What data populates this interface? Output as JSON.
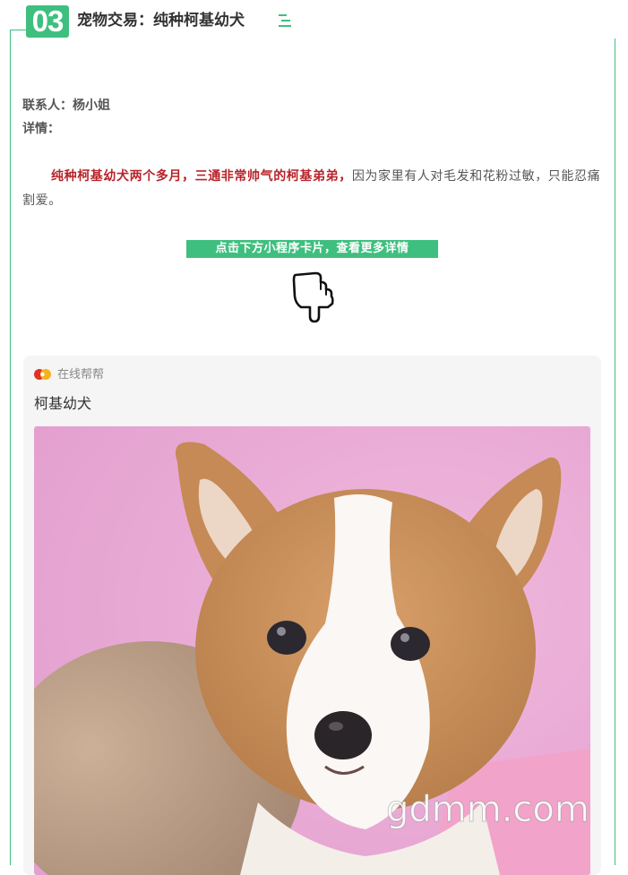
{
  "section": {
    "number": "03",
    "title": "宠物交易：纯种柯基幼犬",
    "title_icon": "menu-lines-icon"
  },
  "contact": {
    "text": "联系人：杨小姐"
  },
  "details": {
    "label": "详情："
  },
  "description": {
    "highlight": "纯种柯基幼犬两个多月，三通非常帅气的柯基弟弟，",
    "rest": "因为家里有人对毛发和花粉过敏，只能忍痛割爱。"
  },
  "cta": {
    "text": "点击下方小程序卡片，查看更多详情",
    "icon": "pointing-hand-down-icon"
  },
  "mini_program_card": {
    "source_name": "在线帮帮",
    "source_icon": "app-logo-icon",
    "title": "柯基幼犬",
    "image_label": "corgi puppy photo",
    "watermark": "gdmm.com"
  },
  "colors": {
    "accent_green": "#3fbf7f",
    "highlight_red": "#b8232a",
    "card_bg": "#f5f5f5",
    "photo_bg_pink": "#e9a9d6"
  }
}
